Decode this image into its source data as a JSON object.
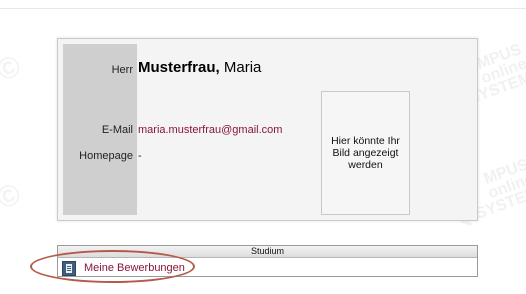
{
  "watermark": {
    "line1": "CAMPUS",
    "line2": "online",
    "line3": "Q-SYSTEM",
    "short": "MPUS"
  },
  "profile": {
    "salutation": "Herr",
    "last_name": "Musterfrau,",
    "first_name": "Maria",
    "email_label": "E-Mail",
    "email_value": "maria.musterfrau@gmail.com",
    "homepage_label": "Homepage",
    "homepage_value": "-",
    "photo_placeholder": "Hier könnte Ihr Bild angezeigt werden"
  },
  "studium": {
    "header": "Studium",
    "items": [
      {
        "label": "Meine Bewerbungen",
        "icon": "document-icon"
      }
    ]
  },
  "colors": {
    "link": "#8a1538",
    "highlight_circle": "#b35a4a"
  }
}
